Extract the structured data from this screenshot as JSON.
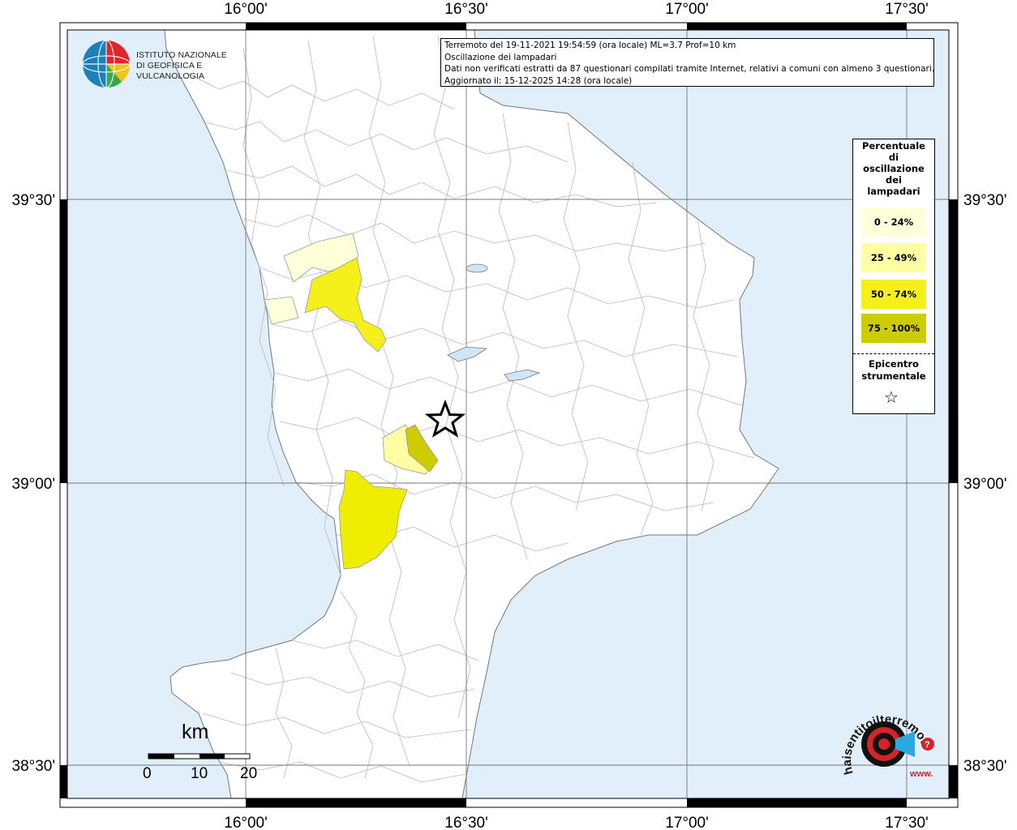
{
  "info": {
    "line1": "Terremoto del 19-11-2021 19:54:59 (ora locale) ML=3.7 Prof=10 km",
    "line2": "Oscillazione dei lampadari",
    "line3": "Dati non verificati estratti da 87 questionari compilati tramite Internet, relativi a comuni con almeno 3 questionari.",
    "line4": "Aggiornato il: 15-12-2025 14:28 (ora locale)"
  },
  "legend": {
    "title": "Percentuale\ndi\noscillazione\ndei\nlampadari",
    "classes": [
      {
        "label": "0 - 24%",
        "color": "#ffffd9"
      },
      {
        "label": "25 - 49%",
        "color": "#ffffa3"
      },
      {
        "label": "50 - 74%",
        "color": "#f5f01c"
      },
      {
        "label": "75 - 100%",
        "color": "#cccc00"
      }
    ],
    "epicenter_label": "Epicentro\nstrumentale",
    "epicenter_symbol": "☆"
  },
  "axes": {
    "longitudes": [
      "16°00'",
      "16°30'",
      "17°00'",
      "17°30'"
    ],
    "latitudes": [
      "39°30'",
      "39°00'",
      "38°30'"
    ]
  },
  "scalebar": {
    "unit": "km",
    "ticks": [
      "0",
      "10",
      "20"
    ]
  },
  "logos": {
    "ingv_line1": "ISTITUTO NAZIONALE",
    "ingv_line2": "DI GEOFISICA E VULCANOLOGIA",
    "hst_text": "haisentitoilterremoto.it",
    "hst_prefix": "www."
  },
  "colors": {
    "sea": "#e0effa",
    "land": "#ffffff",
    "border": "#aaaaaa"
  }
}
